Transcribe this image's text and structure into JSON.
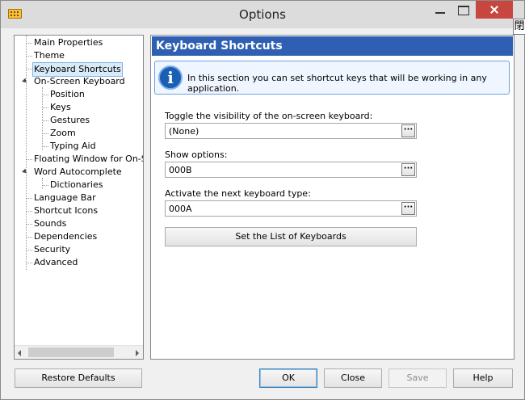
{
  "window": {
    "title": "Options",
    "ime_glyph": "閉"
  },
  "tree": {
    "items": [
      {
        "label": "Main Properties",
        "level": 0,
        "selected": false,
        "expandable": false
      },
      {
        "label": "Theme",
        "level": 0,
        "selected": false,
        "expandable": false
      },
      {
        "label": "Keyboard Shortcuts",
        "level": 0,
        "selected": true,
        "expandable": false
      },
      {
        "label": "On-Screen Keyboard",
        "level": 0,
        "selected": false,
        "expandable": true
      },
      {
        "label": "Position",
        "level": 1,
        "selected": false,
        "expandable": false
      },
      {
        "label": "Keys",
        "level": 1,
        "selected": false,
        "expandable": false
      },
      {
        "label": "Gestures",
        "level": 1,
        "selected": false,
        "expandable": false
      },
      {
        "label": "Zoom",
        "level": 1,
        "selected": false,
        "expandable": false
      },
      {
        "label": "Typing Aid",
        "level": 1,
        "selected": false,
        "expandable": false
      },
      {
        "label": "Floating Window for On-Scre",
        "level": 0,
        "selected": false,
        "expandable": false
      },
      {
        "label": "Word Autocomplete",
        "level": 0,
        "selected": false,
        "expandable": true
      },
      {
        "label": "Dictionaries",
        "level": 1,
        "selected": false,
        "expandable": false
      },
      {
        "label": "Language Bar",
        "level": 0,
        "selected": false,
        "expandable": false
      },
      {
        "label": "Shortcut Icons",
        "level": 0,
        "selected": false,
        "expandable": false
      },
      {
        "label": "Sounds",
        "level": 0,
        "selected": false,
        "expandable": false
      },
      {
        "label": "Dependencies",
        "level": 0,
        "selected": false,
        "expandable": false
      },
      {
        "label": "Security",
        "level": 0,
        "selected": false,
        "expandable": false
      },
      {
        "label": "Advanced",
        "level": 0,
        "selected": false,
        "expandable": false
      }
    ]
  },
  "panel": {
    "header": "Keyboard Shortcuts",
    "info_text": "In this section you can set shortcut keys that will be working in any application.",
    "fields": [
      {
        "label": "Toggle the visibility of the on-screen keyboard:",
        "value": "(None)"
      },
      {
        "label": "Show options:",
        "value": "000B"
      },
      {
        "label": "Activate the next keyboard type:",
        "value": "000A"
      }
    ],
    "ellipsis": "···",
    "set_list_button": "Set the List of Keyboards"
  },
  "footer": {
    "restore_defaults": "Restore Defaults",
    "ok": "OK",
    "close": "Close",
    "save": "Save",
    "help": "Help"
  },
  "colors": {
    "header_bg": "#2f5fb3",
    "info_border": "#6da0dc",
    "close_button": "#c7463f",
    "selection_bg": "#d9ebf9"
  }
}
